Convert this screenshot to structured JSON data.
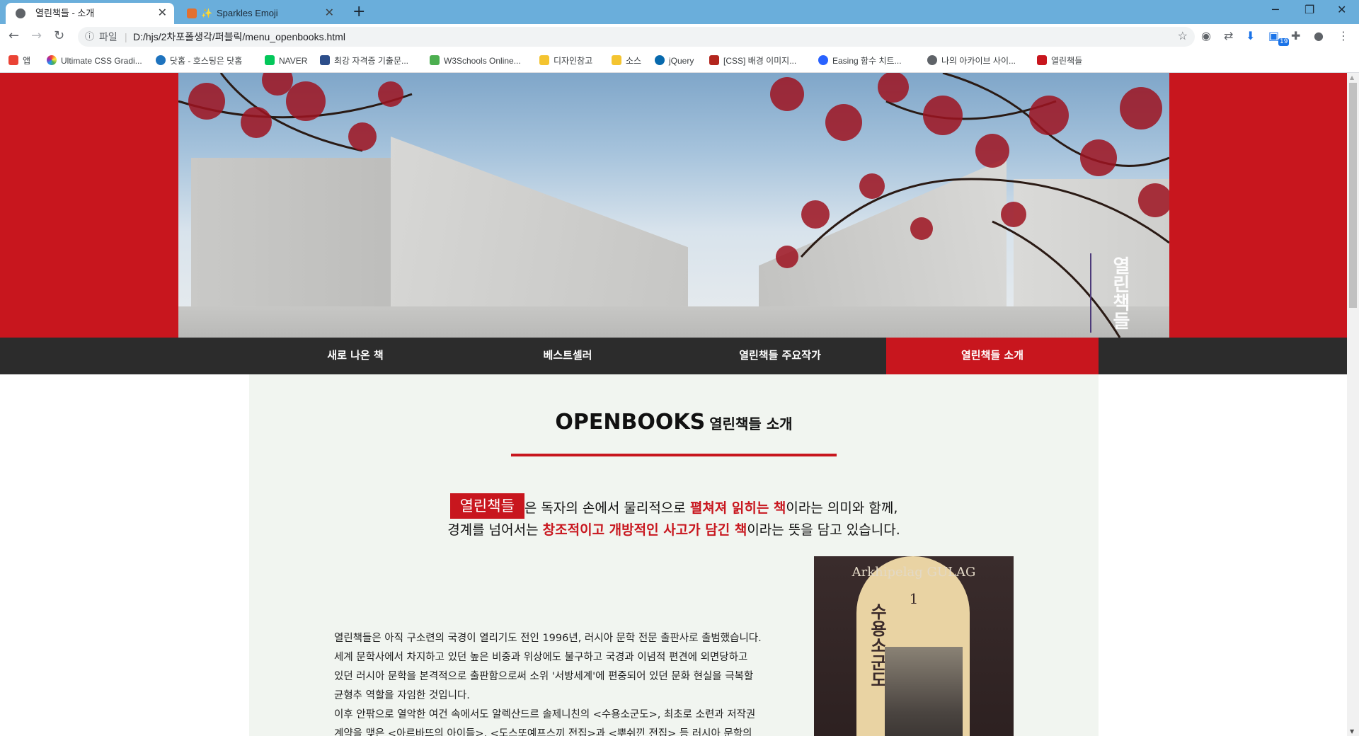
{
  "browser": {
    "tabs": [
      {
        "title": "열린책들 - 소개",
        "active": true
      },
      {
        "title": "Sparkles Emoji",
        "active": false
      }
    ],
    "new_tab_label": "+",
    "window_controls": {
      "minimize": "─",
      "maximize": "❐",
      "close": "✕"
    },
    "address": {
      "scheme_label": "파일",
      "separator": "|",
      "url": "D:/hjs/2차포폴생각/퍼블릭/menu_openbooks.html"
    },
    "extension_badge": "19",
    "bookmarks": [
      {
        "label": "앱",
        "icon": "apps-icon",
        "color": "#ea4335"
      },
      {
        "label": "Ultimate CSS Gradi...",
        "icon": "gradient-icon",
        "color": "#8e44ad"
      },
      {
        "label": "닷홈 - 호스팅은 닷홈",
        "icon": "dothome-icon",
        "color": "#1e73be"
      },
      {
        "label": "NAVER",
        "icon": "naver-icon",
        "color": "#03c75a"
      },
      {
        "label": "최강 자격증 기출문...",
        "icon": "gsc-icon",
        "color": "#2d4e8a"
      },
      {
        "label": "W3Schools Online...",
        "icon": "w3schools-icon",
        "color": "#4caf50"
      },
      {
        "label": "디자인참고",
        "icon": "folder-icon",
        "color": "#f4c430"
      },
      {
        "label": "소스",
        "icon": "folder-icon",
        "color": "#f4c430"
      },
      {
        "label": "jQuery",
        "icon": "jquery-icon",
        "color": "#0769ad"
      },
      {
        "label": "[CSS] 배경 이미지...",
        "icon": "tistory-icon",
        "color": "#b3261e"
      },
      {
        "label": "Easing 함수 치트...",
        "icon": "easing-icon",
        "color": "#2962ff"
      },
      {
        "label": "나의 아카이브 사이...",
        "icon": "globe-icon",
        "color": "#5f6368"
      },
      {
        "label": "열린책들",
        "icon": "openbooks-icon",
        "color": "#c8161e"
      }
    ]
  },
  "site": {
    "hero_logo": "열린책들",
    "nav": [
      {
        "label": "새로 나온 책",
        "active": false
      },
      {
        "label": "베스트셀러",
        "active": false
      },
      {
        "label": "열린책들 주요작가",
        "active": false
      },
      {
        "label": "열린책들 소개",
        "active": true
      }
    ],
    "section_title_en": "OPENBOOKS",
    "section_title_ko": "열린책들 소개",
    "intro": {
      "tag": "열린책들",
      "line1_a": "은 독자의 손에서 물리적으로 ",
      "line1_hl": "펼쳐져 읽히는 책",
      "line1_b": "이라는 의미와 함께,",
      "line2_a": "경계를 넘어서는 ",
      "line2_hl": "창조적이고 개방적인 사고가 담긴 책",
      "line2_b": "이라는 뜻을 담고 있습니다."
    },
    "body": [
      "열린책들은 아직 구소련의 국경이 열리기도 전인 1996년, 러시아 문학 전문 출판사로 출범했습니다.",
      "세계 문학사에서 차지하고 있던 높은 비중과 위상에도 불구하고 국경과 이념적 편견에 외면당하고",
      "있던 러시아 문학을 본격적으로 출판함으로써 소위 '서방세계'에 편중되어 있던 문화 현실을 극복할",
      "균형추 역할을 자임한 것입니다.",
      "이후 안팎으로 열악한 여건 속에서도 알렉산드르 솔제니친의 <수용소군도>, 최초로 소련과 저작권",
      "계약을 맺은 <아르바뜨의 아이들>, <도스또예프스끼 전집>과 <뿌쉬낀 전집> 등 러시아 문학의"
    ],
    "book": {
      "cover_title": "Arkhipelag GULAG",
      "volume": "1",
      "korean_title": "수용소군도"
    }
  },
  "colors": {
    "brand_red": "#c8161e",
    "nav_dark": "#2c2c2c",
    "content_bg": "#f1f5f0",
    "tab_strip": "#6aaedb"
  }
}
